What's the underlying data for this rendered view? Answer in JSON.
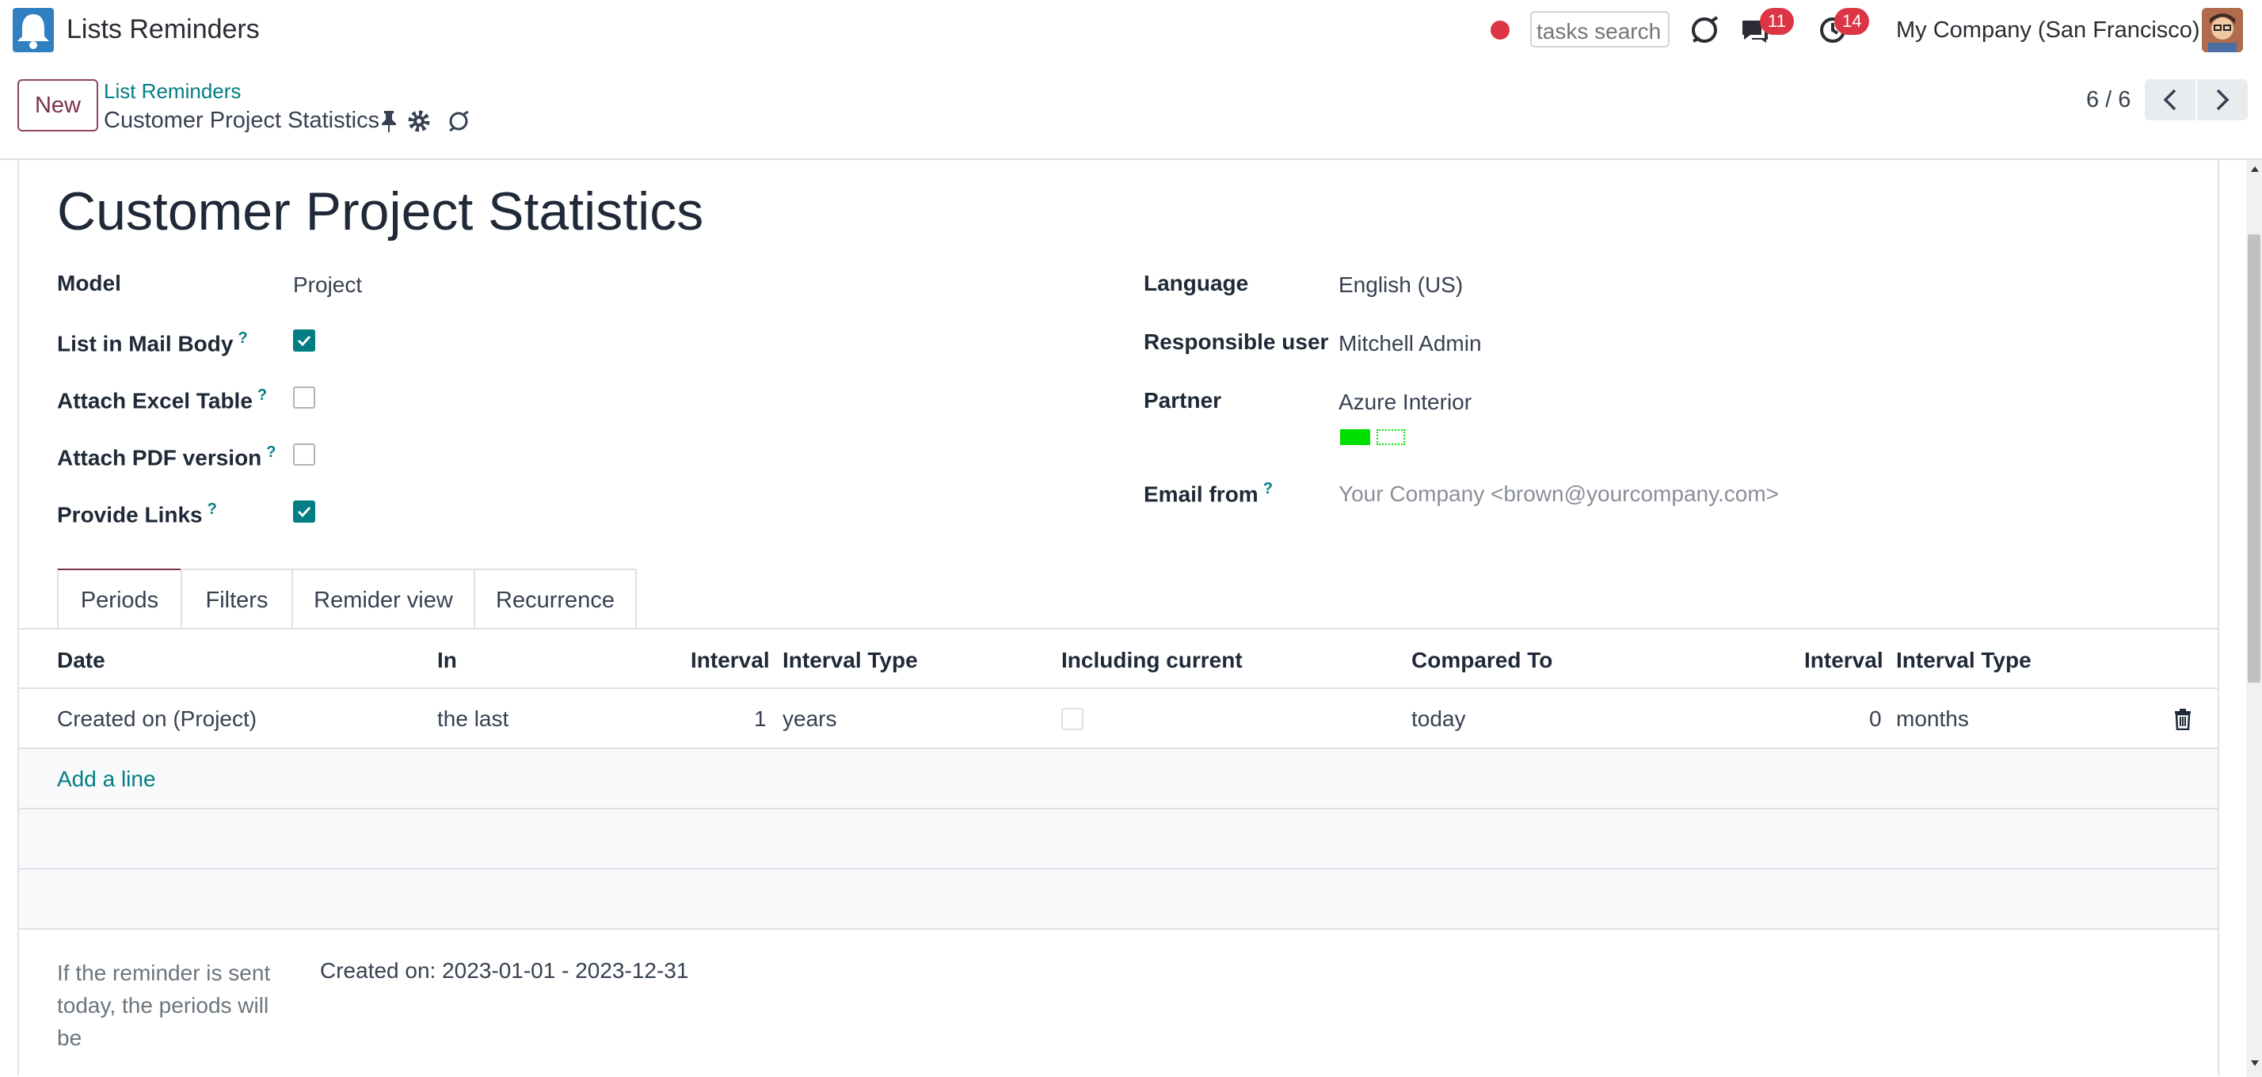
{
  "navbar": {
    "app_title": "Lists Reminders",
    "search_placeholder": "tasks search",
    "messages_count": "11",
    "activities_count": "14",
    "company": "My Company (San Francisco)"
  },
  "control_panel": {
    "new_label": "New",
    "breadcrumb_parent": "List Reminders",
    "breadcrumb_current": "Customer Project Statistics",
    "pager": "6 / 6"
  },
  "record": {
    "title": "Customer Project Statistics",
    "left_fields": {
      "model_label": "Model",
      "model_value": "Project",
      "list_in_mail_body_label": "List in Mail Body",
      "list_in_mail_body": true,
      "attach_excel_label": "Attach Excel Table",
      "attach_excel": false,
      "attach_pdf_label": "Attach PDF version",
      "attach_pdf": false,
      "provide_links_label": "Provide Links",
      "provide_links": true,
      "help_marker": "?"
    },
    "right_fields": {
      "language_label": "Language",
      "language_value": "English (US)",
      "responsible_label": "Responsible user",
      "responsible_value": "Mitchell Admin",
      "partner_label": "Partner",
      "partner_value": "Azure Interior",
      "email_from_label": "Email from",
      "email_from_value": "Your Company <brown@yourcompany.com>"
    }
  },
  "tabs": [
    "Periods",
    "Filters",
    "Remider view",
    "Recurrence"
  ],
  "periods_table": {
    "columns": [
      "Date",
      "In",
      "Interval",
      "Interval Type",
      "Including current",
      "Compared To",
      "Interval",
      "Interval Type"
    ],
    "rows": [
      {
        "date": "Created on (Project)",
        "in": "the last",
        "interval": "1",
        "interval_type": "years",
        "including_current": false,
        "compared_to": "today",
        "interval2": "0",
        "interval_type2": "months"
      }
    ],
    "add_line": "Add a line"
  },
  "summary": {
    "note": "If the reminder is sent today, the periods will be",
    "result": "Created on: 2023-01-01 - 2023-12-31"
  },
  "colors": {
    "accent": "#017e84",
    "brand": "#7b2e4d",
    "badge": "#dc3545",
    "partner_tag": "#00e000"
  }
}
